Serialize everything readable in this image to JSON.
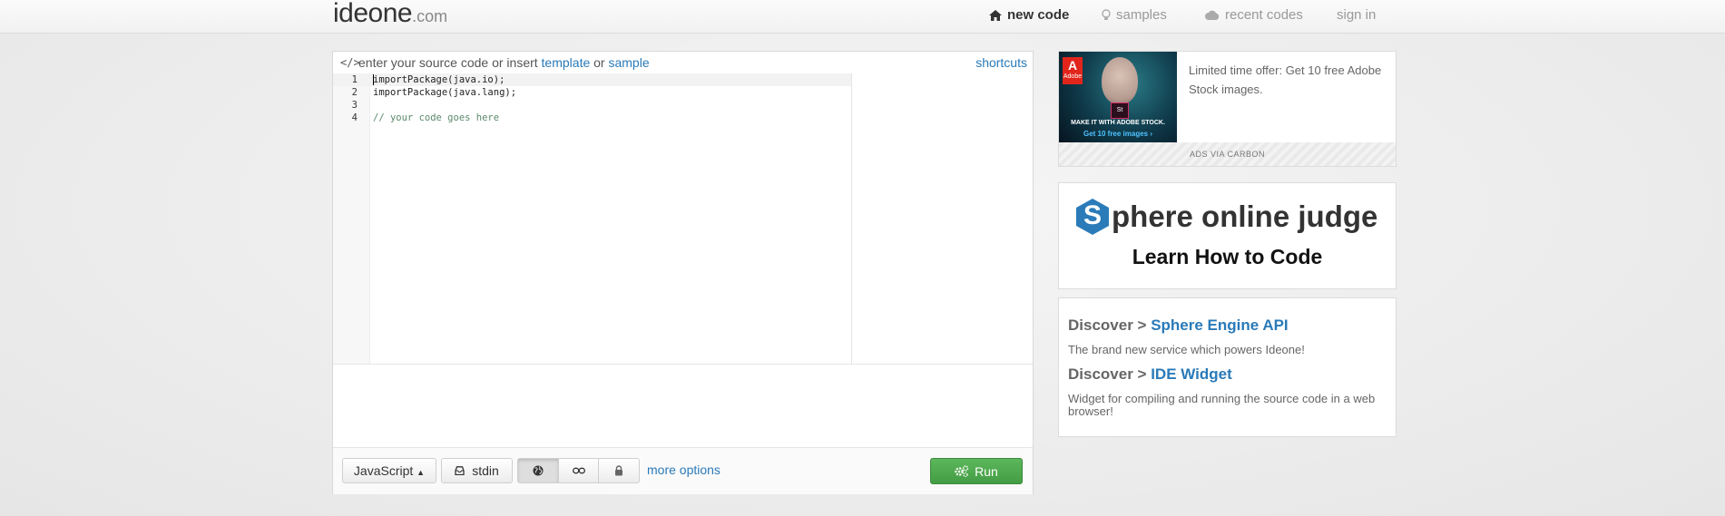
{
  "logo": {
    "main": "ideone",
    "domain": ".com"
  },
  "nav": {
    "new_code": "new code",
    "samples": "samples",
    "recent_codes": "recent codes",
    "sign_in": "sign in"
  },
  "editor": {
    "header": {
      "prompt": "enter your source code or insert",
      "template_link": "template",
      "or": "or",
      "sample_link": "sample",
      "shortcuts": "shortcuts"
    },
    "lines": [
      {
        "num": "1",
        "text": "importPackage(java.io);"
      },
      {
        "num": "2",
        "text": "importPackage(java.lang);"
      },
      {
        "num": "3",
        "text": ""
      },
      {
        "num": "4",
        "text": "// your code goes here"
      }
    ],
    "footer": {
      "language": "JavaScript",
      "stdin": "stdin",
      "more_options": "more options",
      "run": "Run"
    }
  },
  "ad": {
    "text": "Limited time offer: Get 10 free Adobe Stock images.",
    "brand": "Adobe",
    "badge": "St",
    "caption1": "MAKE IT WITH ADOBE STOCK.",
    "caption2": "Get 10 free images ›",
    "via": "ADS VIA CARBON"
  },
  "spoj": {
    "letter": "S",
    "title_rest": "phere online judge",
    "subtitle": "Learn How to Code"
  },
  "discover": [
    {
      "prefix": "Discover > ",
      "link": "Sphere Engine API",
      "desc": "The brand new service which powers Ideone!"
    },
    {
      "prefix": "Discover > ",
      "link": "IDE Widget",
      "desc": "Widget for compiling and running the source code in a web browser!"
    }
  ],
  "colors": {
    "link": "#2a7ab8",
    "run": "#4cae4c",
    "spoj_blue": "#2b7bb9"
  }
}
